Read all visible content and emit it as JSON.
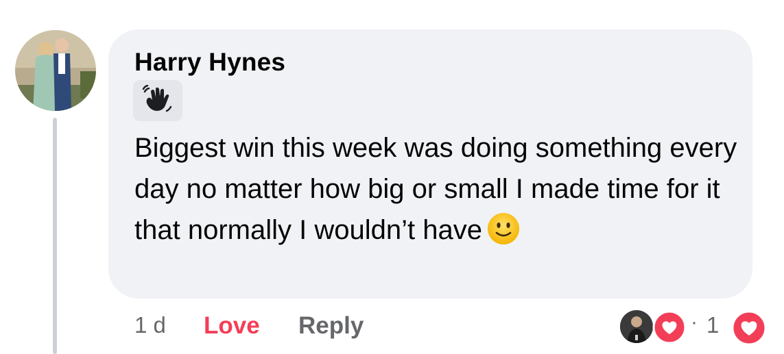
{
  "comment": {
    "author": "Harry Hynes",
    "badge_icon": "waving-hand-icon",
    "text": "Biggest win this week was doing something every day no matter how big or small I made time for it that normally I wouldn’t have",
    "emoji": "slightly-smiling-face-icon"
  },
  "actions": {
    "time": "1 d",
    "love_label": "Love",
    "reply_label": "Reply",
    "reaction_separator": "·",
    "reaction_count": "1",
    "reaction_type": "love"
  },
  "colors": {
    "love": "#f33e58",
    "bubble": "#f0f2f5",
    "secondary_text": "#65676b"
  }
}
